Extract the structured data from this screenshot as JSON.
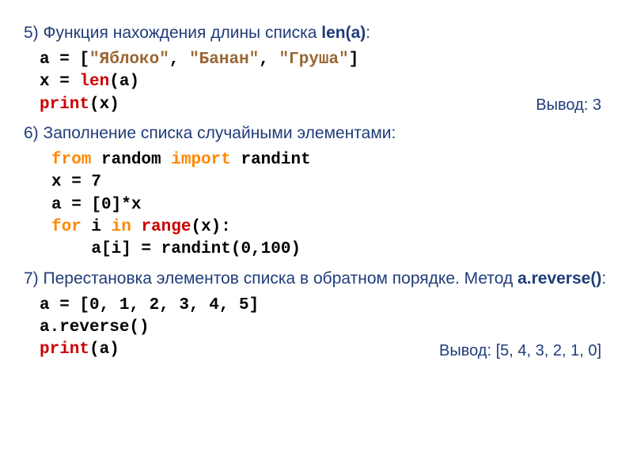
{
  "section5": {
    "heading_prefix": "5) Функция нахождения длины списка ",
    "heading_bold": "len(a)",
    "heading_suffix": ":",
    "code": {
      "l1a": "a = [",
      "l1b": "\"Яблоко\"",
      "l1c": ", ",
      "l1d": "\"Банан\"",
      "l1e": ", ",
      "l1f": "\"Груша\"",
      "l1g": "]",
      "l2a": "x = ",
      "l2b": "len",
      "l2c": "(a)",
      "l3a": "print",
      "l3b": "(x)"
    },
    "output": "Вывод: 3"
  },
  "section6": {
    "heading": "6) Заполнение списка случайными элементами:",
    "code": {
      "l1a": "from",
      "l1b": " random ",
      "l1c": "import",
      "l1d": " randint",
      "l2": "x = 7",
      "l3": "a = [0]*x",
      "l4a": "for",
      "l4b": " i ",
      "l4c": "in",
      "l4d": " ",
      "l4e": "range",
      "l4f": "(x):",
      "l5": "    a[i] = randint(0,100)"
    }
  },
  "section7": {
    "heading_prefix": "7) Перестановка элементов списка в обратном порядке. Метод ",
    "heading_bold": "a.reverse()",
    "heading_suffix": ":",
    "code": {
      "l1": "a = [0, 1, 2, 3, 4, 5]",
      "l2": "a.reverse()",
      "l3a": "print",
      "l3b": "(a)"
    },
    "output": "Вывод: [5, 4, 3, 2, 1, 0]"
  }
}
